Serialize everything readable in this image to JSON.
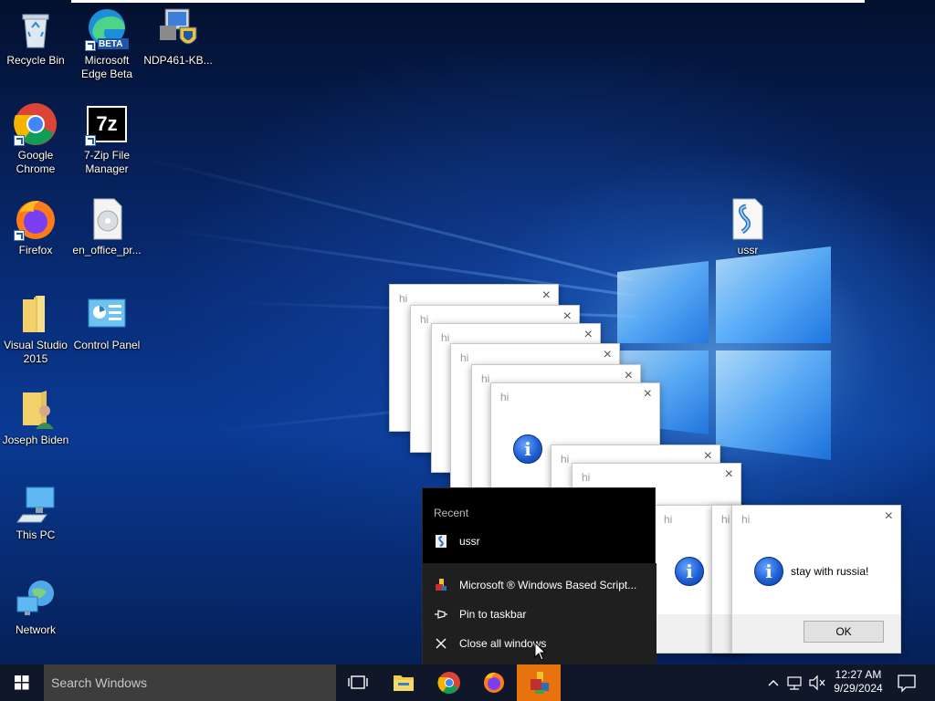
{
  "desktop_icons": [
    {
      "label": "Recycle Bin",
      "icon": "recycle-bin-icon"
    },
    {
      "label": "Microsoft Edge Beta",
      "icon": "edge-beta-icon",
      "badge": "BETA"
    },
    {
      "label": "NDP461-KB...",
      "icon": "installer-icon"
    },
    {
      "label": "Google Chrome",
      "icon": "chrome-icon"
    },
    {
      "label": "7-Zip File Manager",
      "icon": "7zip-icon",
      "glyph": "7z"
    },
    {
      "label": "Firefox",
      "icon": "firefox-icon"
    },
    {
      "label": "en_office_pr...",
      "icon": "disc-image-icon"
    },
    {
      "label": "Visual Studio 2015",
      "icon": "folder-icon"
    },
    {
      "label": "Control Panel",
      "icon": "control-panel-icon"
    },
    {
      "label": "Joseph Biden",
      "icon": "user-folder-icon"
    },
    {
      "label": "This PC",
      "icon": "computer-icon"
    },
    {
      "label": "Network",
      "icon": "network-icon"
    },
    {
      "label": "ussr",
      "icon": "script-file-icon"
    }
  ],
  "dialog": {
    "title": "hi",
    "message": "stay with russia!",
    "ok_label": "OK",
    "close_glyph": "×"
  },
  "jumplist": {
    "section_header": "Recent",
    "recent_items": [
      {
        "label": "ussr",
        "icon": "script-file-icon"
      }
    ],
    "tasks": [
      {
        "label": "Microsoft ® Windows Based Script...",
        "icon": "wscript-icon"
      },
      {
        "label": "Pin to taskbar",
        "icon": "pin-icon"
      },
      {
        "label": "Close all windows",
        "icon": "close-icon"
      }
    ]
  },
  "taskbar": {
    "search_placeholder": "Search Windows",
    "apps": [
      "task-view-icon",
      "file-explorer-icon",
      "chrome-icon",
      "firefox-icon",
      "wscript-icon"
    ],
    "active_app": "wscript-icon",
    "clock_time": "12:27 AM",
    "clock_date": "9/29/2024"
  },
  "colors": {
    "taskbar": "#0f1729",
    "search_box": "#3d3d3d",
    "active_app_highlight": "#e8730c",
    "info_blue": "#1e5fd4"
  }
}
